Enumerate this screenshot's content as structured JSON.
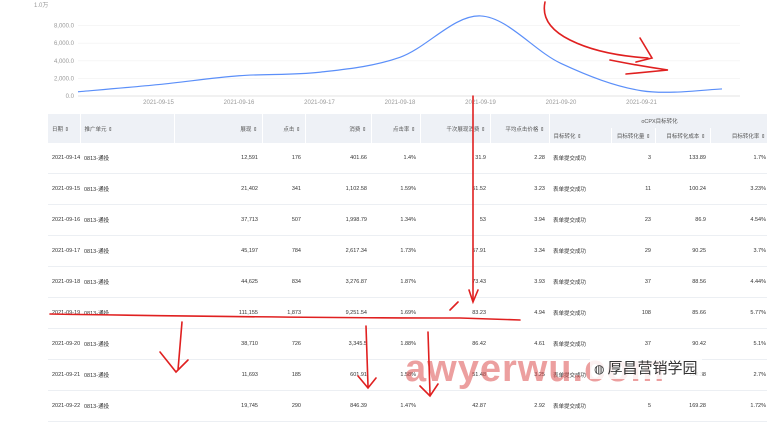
{
  "chart_data": {
    "type": "line",
    "y_unit_label": "1.0万",
    "y_ticks": [
      "8,000.0",
      "6,000.0",
      "4,000.0",
      "2,000.0",
      "0.0"
    ],
    "x_ticks": [
      "2021-09-15",
      "2021-09-16",
      "2021-09-17",
      "2021-09-18",
      "2021-09-19",
      "2021-09-20",
      "2021-09-21"
    ],
    "ylim": [
      0,
      10000
    ],
    "color": "#5b8ff9",
    "series": [
      {
        "x": [
          "2021-09-14",
          "2021-09-15",
          "2021-09-16",
          "2021-09-17",
          "2021-09-18",
          "2021-09-19",
          "2021-09-20",
          "2021-09-21",
          "2021-09-22"
        ],
        "values": [
          480,
          1300,
          2300,
          2700,
          4400,
          9100,
          3700,
          600,
          800
        ]
      }
    ]
  },
  "table": {
    "group_header": "oCPX目标转化",
    "headers": [
      "日期 ⇕",
      "推广单元 ⇕",
      "展现 ⇕",
      "点击 ⇕",
      "消费 ⇕",
      "点击率 ⇕",
      "千次展现消费 ⇕",
      "平均点击价格 ⇕",
      "目标转化 ⇕",
      "目标转化量 ⇕",
      "目标转化成本 ⇕",
      "目标转化率 ⇕"
    ],
    "rows": [
      [
        "2021-09-14",
        "0813-通投",
        "12,591",
        "176",
        "401.66",
        "1.4%",
        "31.9",
        "2.28",
        "表单提交成功",
        "3",
        "133.89",
        "1.7%"
      ],
      [
        "2021-09-15",
        "0813-通投",
        "21,402",
        "341",
        "1,102.58",
        "1.59%",
        "51.52",
        "3.23",
        "表单提交成功",
        "11",
        "100.24",
        "3.23%"
      ],
      [
        "2021-09-16",
        "0813-通投",
        "37,713",
        "507",
        "1,998.79",
        "1.34%",
        "53",
        "3.94",
        "表单提交成功",
        "23",
        "86.9",
        "4.54%"
      ],
      [
        "2021-09-17",
        "0813-通投",
        "45,197",
        "784",
        "2,617.34",
        "1.73%",
        "57.91",
        "3.34",
        "表单提交成功",
        "29",
        "90.25",
        "3.7%"
      ],
      [
        "2021-09-18",
        "0813-通投",
        "44,625",
        "834",
        "3,276.87",
        "1.87%",
        "73.43",
        "3.93",
        "表单提交成功",
        "37",
        "88.56",
        "4.44%"
      ],
      [
        "2021-09-19",
        "0813-通投",
        "111,155",
        "1,873",
        "9,251.54",
        "1.69%",
        "83.23",
        "4.94",
        "表单提交成功",
        "108",
        "85.66",
        "5.77%"
      ],
      [
        "2021-09-20",
        "0813-通投",
        "38,710",
        "726",
        "3,345.5",
        "1.88%",
        "86.42",
        "4.61",
        "表单提交成功",
        "37",
        "90.42",
        "5.1%"
      ],
      [
        "2021-09-21",
        "0813-通投",
        "11,693",
        "185",
        "601.91",
        "1.58%",
        "51.48",
        "3.25",
        "表单提交成功",
        "5",
        "120.38",
        "2.7%"
      ],
      [
        "2021-09-22",
        "0813-通投",
        "19,745",
        "290",
        "846.39",
        "1.47%",
        "42.87",
        "2.92",
        "表单提交成功",
        "5",
        "169.28",
        "1.72%"
      ]
    ]
  },
  "watermark": "awyerwu.com",
  "wechat_label": "厚昌营销学园",
  "annotation_color": "#e02020"
}
